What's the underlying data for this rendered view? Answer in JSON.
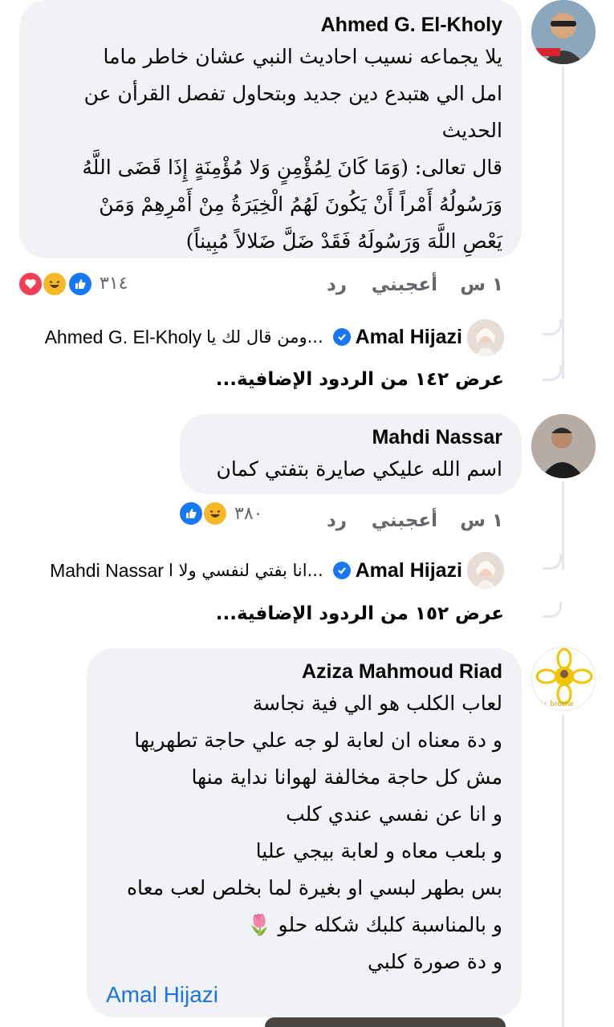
{
  "comments": [
    {
      "author": "Ahmed G. El-Kholy",
      "text": "يلا يجماعه نسيب احاديث النبي عشان خاطر ماما\nامل الي هتبدع دين جديد وبتحاول تفصل القرأن عن\nالحديث",
      "ayah": "قال تعالى: (وَمَا كَانَ لِمُؤْمِنٍ وَلا مُؤْمِنَةٍ إِذَا قَضَى اللَّهُ\nوَرَسُولُهُ أَمْراً أَنْ يَكُونَ لَهُمُ الْخِيَرَةُ مِنْ أَمْرِهِمْ وَمَنْ\nيَعْصِ اللَّهَ وَرَسُولَهُ فَقَدْ ضَلَّ ضَلالاً مُبِيناً)",
      "time": "١ س",
      "like_label": "أعجبني",
      "reply_label": "رد",
      "reaction_count": "٣١٤",
      "reactions": [
        "like-icon",
        "haha-icon",
        "love-icon"
      ],
      "reply_preview": {
        "author": "Amal Hijazi",
        "snippet": "ومن قال لك يا...",
        "mention": "Ahmed G. El-Kholy"
      },
      "more_replies": "عرض ١٤٢ من الردود الإضافية..."
    },
    {
      "author": "Mahdi Nassar",
      "text": "اسم الله عليكي صايرة بتفتي كمان",
      "time": "١ س",
      "like_label": "أعجبني",
      "reply_label": "رد",
      "reaction_count": "٣٨٠",
      "reactions": [
        "like-icon",
        "haha-icon"
      ],
      "reply_preview": {
        "author": "Amal Hijazi",
        "snippet": "انا بفتي لنفسي ولا ا...",
        "mention": "Mahdi Nassar"
      },
      "more_replies": "عرض ١٥٢ من الردود الإضافية..."
    },
    {
      "author": "Aziza Mahmoud Riad",
      "avatar_text": "ly_brothe",
      "text": "لعاب الكلب هو الي فية نجاسة\nو دة معناه ان لعابة لو جه علي حاجة تطهريها\nمش كل حاجة مخالفة لهوانا نداية منها\nو انا عن نفسي عندي كلب\nو بلعب معاه و لعابة بيجي عليا\nبس بطهر لبسي او بغيرة لما بخلص لعب معاه\nو بالمناسبة كلبك شكله حلو 🌷\nو دة صورة كلبي",
      "tag": "Amal Hijazi"
    }
  ],
  "colors": {
    "bubble": "#f0f2f5",
    "meta_text": "#65676b",
    "link": "#1b74e4",
    "verified": "#1877f2"
  }
}
